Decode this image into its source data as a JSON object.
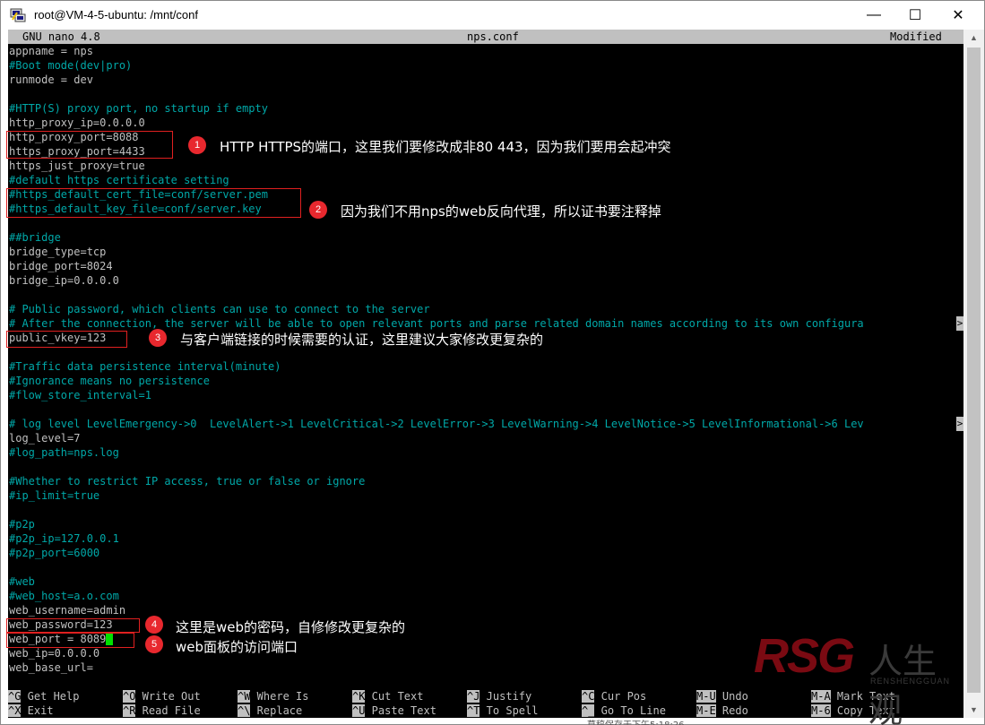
{
  "window": {
    "title": "root@VM-4-5-ubuntu: /mnt/conf",
    "minimize": "—",
    "maximize": "☐",
    "close": "✕"
  },
  "nano": {
    "version": "GNU nano 4.8",
    "filename": "nps.conf",
    "status": "Modified"
  },
  "lines": [
    {
      "text": "appname = nps",
      "type": "normal"
    },
    {
      "text": "#Boot mode(dev|pro)",
      "type": "comment"
    },
    {
      "text": "runmode = dev",
      "type": "normal"
    },
    {
      "text": "",
      "type": "normal"
    },
    {
      "text": "#HTTP(S) proxy port, no startup if empty",
      "type": "comment"
    },
    {
      "text": "http_proxy_ip=0.0.0.0",
      "type": "normal"
    },
    {
      "text": "http_proxy_port=8088",
      "type": "normal"
    },
    {
      "text": "https_proxy_port=4433",
      "type": "normal"
    },
    {
      "text": "https_just_proxy=true",
      "type": "normal"
    },
    {
      "text": "#default https certificate setting",
      "type": "comment"
    },
    {
      "text": "#https_default_cert_file=conf/server.pem",
      "type": "comment"
    },
    {
      "text": "#https_default_key_file=conf/server.key",
      "type": "comment"
    },
    {
      "text": "",
      "type": "normal"
    },
    {
      "text": "##bridge",
      "type": "comment"
    },
    {
      "text": "bridge_type=tcp",
      "type": "normal"
    },
    {
      "text": "bridge_port=8024",
      "type": "normal"
    },
    {
      "text": "bridge_ip=0.0.0.0",
      "type": "normal"
    },
    {
      "text": "",
      "type": "normal"
    },
    {
      "text": "# Public password, which clients can use to connect to the server",
      "type": "comment"
    },
    {
      "text": "# After the connection, the server will be able to open relevant ports and parse related domain names according to its own configura",
      "type": "comment",
      "truncated": true
    },
    {
      "text": "public_vkey=123",
      "type": "normal"
    },
    {
      "text": "",
      "type": "normal"
    },
    {
      "text": "#Traffic data persistence interval(minute)",
      "type": "comment"
    },
    {
      "text": "#Ignorance means no persistence",
      "type": "comment"
    },
    {
      "text": "#flow_store_interval=1",
      "type": "comment"
    },
    {
      "text": "",
      "type": "normal"
    },
    {
      "text": "# log level LevelEmergency->0  LevelAlert->1 LevelCritical->2 LevelError->3 LevelWarning->4 LevelNotice->5 LevelInformational->6 Lev",
      "type": "comment",
      "truncated": true
    },
    {
      "text": "log_level=7",
      "type": "normal"
    },
    {
      "text": "#log_path=nps.log",
      "type": "comment"
    },
    {
      "text": "",
      "type": "normal"
    },
    {
      "text": "#Whether to restrict IP access, true or false or ignore",
      "type": "comment"
    },
    {
      "text": "#ip_limit=true",
      "type": "comment"
    },
    {
      "text": "",
      "type": "normal"
    },
    {
      "text": "#p2p",
      "type": "comment"
    },
    {
      "text": "#p2p_ip=127.0.0.1",
      "type": "comment"
    },
    {
      "text": "#p2p_port=6000",
      "type": "comment"
    },
    {
      "text": "",
      "type": "normal"
    },
    {
      "text": "#web",
      "type": "comment"
    },
    {
      "text": "#web_host=a.o.com",
      "type": "comment"
    },
    {
      "text": "web_username=admin",
      "type": "normal"
    },
    {
      "text": "web_password=123",
      "type": "normal"
    },
    {
      "text": "web_port = 8089",
      "type": "normal",
      "cursor": true
    },
    {
      "text": "web_ip=0.0.0.0",
      "type": "normal"
    },
    {
      "text": "web_base_url=",
      "type": "normal"
    }
  ],
  "truncation_marker": ">",
  "shortcuts": [
    {
      "key": "^G",
      "label": " Get Help"
    },
    {
      "key": "^O",
      "label": " Write Out"
    },
    {
      "key": "^W",
      "label": " Where Is"
    },
    {
      "key": "^K",
      "label": " Cut Text"
    },
    {
      "key": "^J",
      "label": " Justify"
    },
    {
      "key": "^C",
      "label": " Cur Pos"
    },
    {
      "key": "M-U",
      "label": " Undo"
    },
    {
      "key": "M-A",
      "label": " Mark Text"
    },
    {
      "key": "^X",
      "label": " Exit"
    },
    {
      "key": "^R",
      "label": " Read File"
    },
    {
      "key": "^\\",
      "label": " Replace"
    },
    {
      "key": "^U",
      "label": " Paste Text"
    },
    {
      "key": "^T",
      "label": " To Spell"
    },
    {
      "key": "^_",
      "label": " Go To Line"
    },
    {
      "key": "M-E",
      "label": " Redo"
    },
    {
      "key": "M-6",
      "label": " Copy Text"
    }
  ],
  "annotations": [
    {
      "num": "1",
      "text": "HTTP  HTTPS的端口，这里我们要修改成非80 443，因为我们要用会起冲突"
    },
    {
      "num": "2",
      "text": "因为我们不用nps的web反向代理，所以证书要注释掉"
    },
    {
      "num": "3",
      "text": "与客户端链接的时候需要的认证，这里建议大家修改更复杂的"
    },
    {
      "num": "4",
      "text": "这里是web的密码，自修修改更复杂的"
    },
    {
      "num": "5",
      "text": "web面板的访问端口"
    }
  ],
  "watermark": {
    "brand": "RSG",
    "cn": "人生观",
    "sub": "RENSHENGGUAN"
  },
  "taskbar_hint": "草稿保存于下午5:18:26"
}
